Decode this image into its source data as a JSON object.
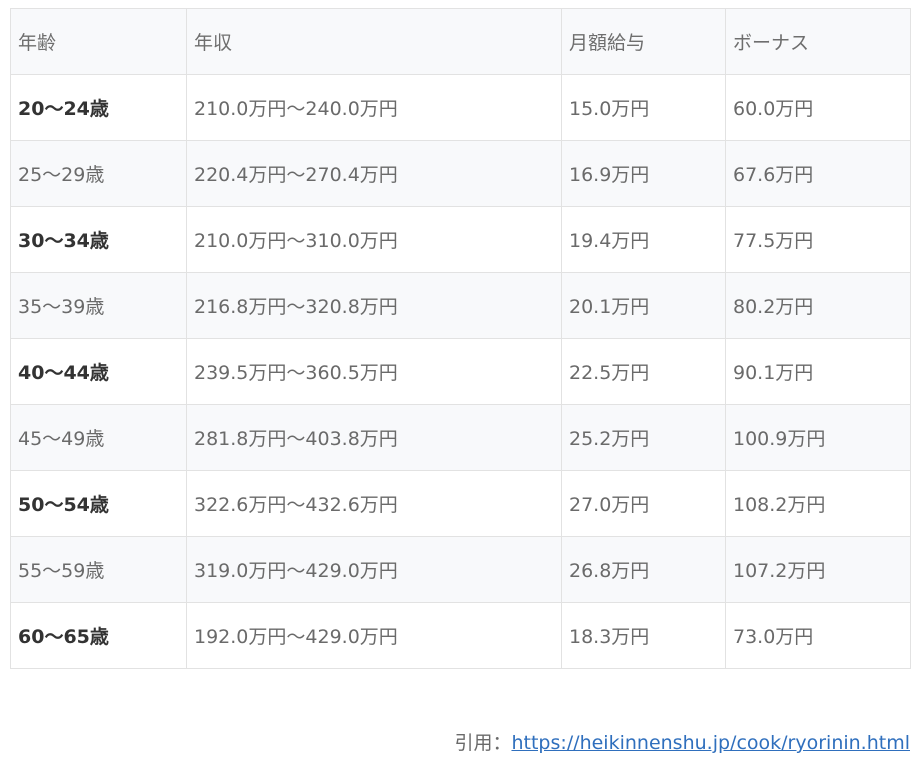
{
  "table": {
    "headers": [
      "年齢",
      "年収",
      "月額給与",
      "ボーナス"
    ],
    "rows": [
      {
        "age": "20〜24歳",
        "annual": "210.0万円〜240.0万円",
        "monthly": "15.0万円",
        "bonus": "60.0万円"
      },
      {
        "age": "25〜29歳",
        "annual": "220.4万円〜270.4万円",
        "monthly": "16.9万円",
        "bonus": "67.6万円"
      },
      {
        "age": "30〜34歳",
        "annual": "210.0万円〜310.0万円",
        "monthly": "19.4万円",
        "bonus": "77.5万円"
      },
      {
        "age": "35〜39歳",
        "annual": "216.8万円〜320.8万円",
        "monthly": "20.1万円",
        "bonus": "80.2万円"
      },
      {
        "age": "40〜44歳",
        "annual": "239.5万円〜360.5万円",
        "monthly": "22.5万円",
        "bonus": "90.1万円"
      },
      {
        "age": "45〜49歳",
        "annual": "281.8万円〜403.8万円",
        "monthly": "25.2万円",
        "bonus": "100.9万円"
      },
      {
        "age": "50〜54歳",
        "annual": "322.6万円〜432.6万円",
        "monthly": "27.0万円",
        "bonus": "108.2万円"
      },
      {
        "age": "55〜59歳",
        "annual": "319.0万円〜429.0万円",
        "monthly": "26.8万円",
        "bonus": "107.2万円"
      },
      {
        "age": "60〜65歳",
        "annual": "192.0万円〜429.0万円",
        "monthly": "18.3万円",
        "bonus": "73.0万円"
      }
    ]
  },
  "citation": {
    "prefix": "引用：",
    "link_text": "https://heikinnenshu.jp/cook/ryorinin.html"
  },
  "colors": {
    "row_shade": "#f8f9fb",
    "border": "#e2e2e2",
    "link": "#2f6fbd",
    "bold_text": "#333333"
  }
}
